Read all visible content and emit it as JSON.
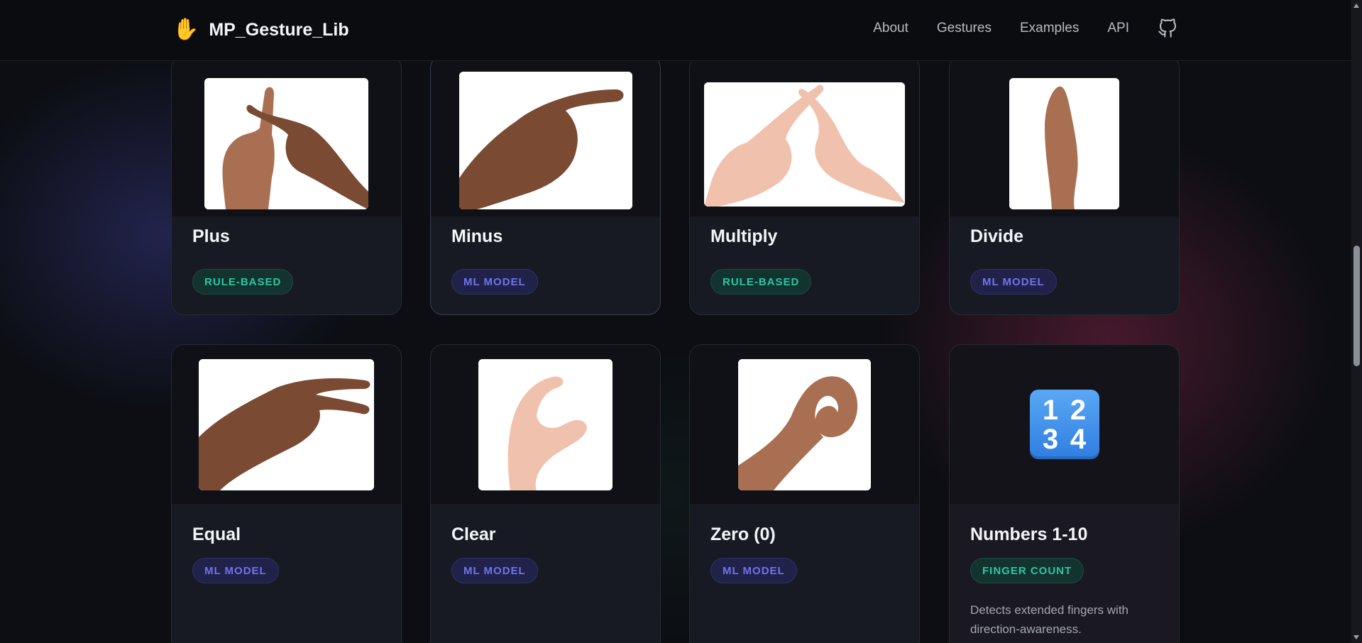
{
  "brand": {
    "icon": "✋",
    "name": "MP_Gesture_Lib"
  },
  "nav": {
    "items": [
      "About",
      "Gestures",
      "Examples",
      "API"
    ],
    "github_icon": "github-icon"
  },
  "cards": [
    {
      "title": "Plus",
      "badge": "RULE-BASED",
      "badge_type": "rule",
      "image": "crossed-index-fingers-hand-photo"
    },
    {
      "title": "Minus",
      "badge": "ML MODEL",
      "badge_type": "ml",
      "image": "horizontal-index-finger-hand-photo"
    },
    {
      "title": "Multiply",
      "badge": "RULE-BASED",
      "badge_type": "rule",
      "image": "crossed-fingers-x-hands-photo"
    },
    {
      "title": "Divide",
      "badge": "ML MODEL",
      "badge_type": "ml",
      "image": "vertical-flat-hand-photo"
    },
    {
      "title": "Equal",
      "badge": "ML MODEL",
      "badge_type": "ml",
      "image": "two-fingers-horizontal-hand-photo"
    },
    {
      "title": "Clear",
      "badge": "ML MODEL",
      "badge_type": "ml",
      "image": "c-shape-hand-photo"
    },
    {
      "title": "Zero (0)",
      "badge": "ML MODEL",
      "badge_type": "ml",
      "image": "ok-circle-hand-photo"
    },
    {
      "title": "Numbers 1-10",
      "badge": "FINGER COUNT",
      "badge_type": "rule",
      "image": "numbers-1234-emoji",
      "icon_digits": [
        "1",
        "2",
        "3",
        "4"
      ],
      "description": "Detects extended fingers with direction-awareness."
    }
  ],
  "colors": {
    "rule_badge": "#2bc6a4",
    "ml_badge": "#6f74ec",
    "accent_red": "#96284f",
    "accent_blue": "#4646aa"
  }
}
